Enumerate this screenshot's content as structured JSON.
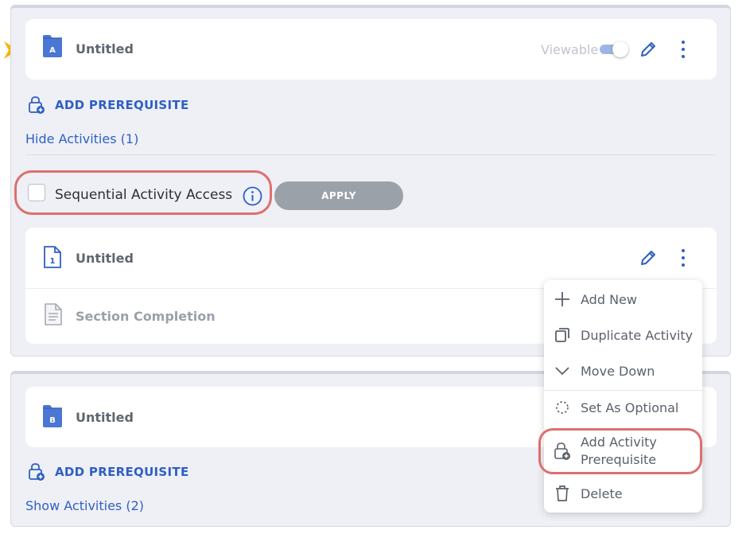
{
  "colors": {
    "accent": "#2f5fc4",
    "panel_bg": "#eef0f5",
    "highlight": "#de6f6f",
    "apply_bg": "#9ba1a9",
    "marker": "#f5b400"
  },
  "section_a": {
    "badge": "A",
    "title": "Untitled",
    "viewable_label": "Viewable",
    "viewable_on": true,
    "add_prerequisite": "ADD PREREQUISITE",
    "hide_activities": "Hide Activities (1)",
    "sequential_access_label": "Sequential Activity Access",
    "apply_label": "APPLY",
    "activity": {
      "badge": "1",
      "title": "Untitled",
      "completion_label": "Section Completion"
    }
  },
  "section_b": {
    "badge": "B",
    "title": "Untitled",
    "add_prerequisite": "ADD PREREQUISITE",
    "show_activities": "Show Activities (2)"
  },
  "context_menu": {
    "add_new": "Add New",
    "duplicate": "Duplicate Activity",
    "move_down": "Move Down",
    "set_optional": "Set As Optional",
    "add_prereq_line1": "Add Activity",
    "add_prereq_line2": "Prerequisite",
    "delete": "Delete"
  }
}
